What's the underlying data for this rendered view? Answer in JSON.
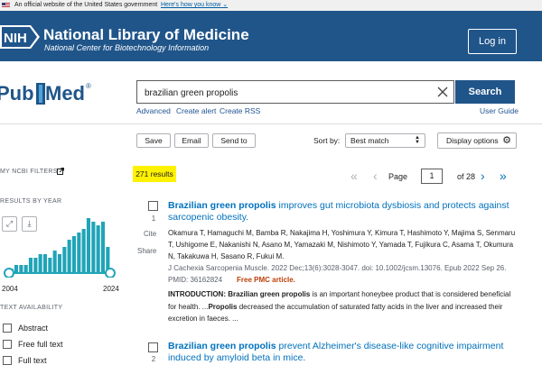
{
  "gov_banner": {
    "text": "An official website of the United States government",
    "link": "Here's how you know"
  },
  "header": {
    "title": "National Library of Medicine",
    "subtitle": "National Center for Biotechnology Information",
    "login": "Log in",
    "nih": "NIH"
  },
  "brand": {
    "pubmed_a": "Pub",
    "pubmed_b": "Med",
    "reg": "®"
  },
  "search": {
    "value": "brazilian green propolis",
    "button": "Search"
  },
  "links": {
    "advanced": "Advanced",
    "create_alert": "Create alert",
    "create_rss": "Create RSS",
    "user_guide": "User Guide"
  },
  "toolbar": {
    "save": "Save",
    "email": "Email",
    "send_to": "Send to",
    "sort_by": "Sort by:",
    "sort_value": "Best match",
    "display": "Display options"
  },
  "sidebar": {
    "filters": "MY NCBI FILTERS",
    "results_by_year": "RESULTS BY YEAR",
    "year_start": "2004",
    "year_end": "2024",
    "histogram": [
      1,
      2,
      2,
      2,
      4,
      4,
      5,
      5,
      4,
      6,
      5,
      7,
      9,
      10,
      11,
      12,
      15,
      14,
      13,
      14,
      7
    ],
    "text_availability": "TEXT AVAILABILITY",
    "abstract": "Abstract",
    "free_full_text": "Free full text",
    "full_text": "Full text"
  },
  "results": {
    "count": "271 results",
    "page_label": "Page",
    "page": "1",
    "of": "of 28"
  },
  "articles": [
    {
      "num": "1",
      "cite": "Cite",
      "share": "Share",
      "title_hl": "Brazilian green propolis",
      "title_rest": " improves gut microbiota dysbiosis and protects against sarcopenic obesity.",
      "authors": "Okamura T, Hamaguchi M, Bamba R, Nakajima H, Yoshimura Y, Kimura T, Hashimoto Y, Majima S, Senmaru T, Ushigome E, Nakanishi N, Asano M, Yamazaki M, Nishimoto Y, Yamada T, Fujikura C, Asama T, Okumura N, Takakuwa H, Sasano R, Fukui M.",
      "citation": "J Cachexia Sarcopenia Muscle. 2022 Dec;13(6):3028-3047. doi: 10.1002/jcsm.13076. Epub 2022 Sep 26.",
      "pmid": "PMID: 36162824",
      "pmc": "Free PMC article.",
      "snip_a": "INTRODUCTION: ",
      "snip_hl1": "Brazilian green propolis",
      "snip_b": " is an important honeybee product that is considered beneficial for health. ...",
      "snip_hl2": "Propolis",
      "snip_c": " decreased the accumulation of saturated fatty acids in the liver and increased their excretion in faeces. ..."
    },
    {
      "num": "2",
      "title_hl": "Brazilian green propolis",
      "title_rest": " prevent Alzheimer's disease-like cognitive impairment induced by amyloid beta in mice."
    }
  ],
  "colors": {
    "header_bg": "#20558a",
    "link": "#0071bc",
    "highlight": "#fff200",
    "chart_bar": "#20a4b8",
    "pmc": "#bd3f09"
  }
}
